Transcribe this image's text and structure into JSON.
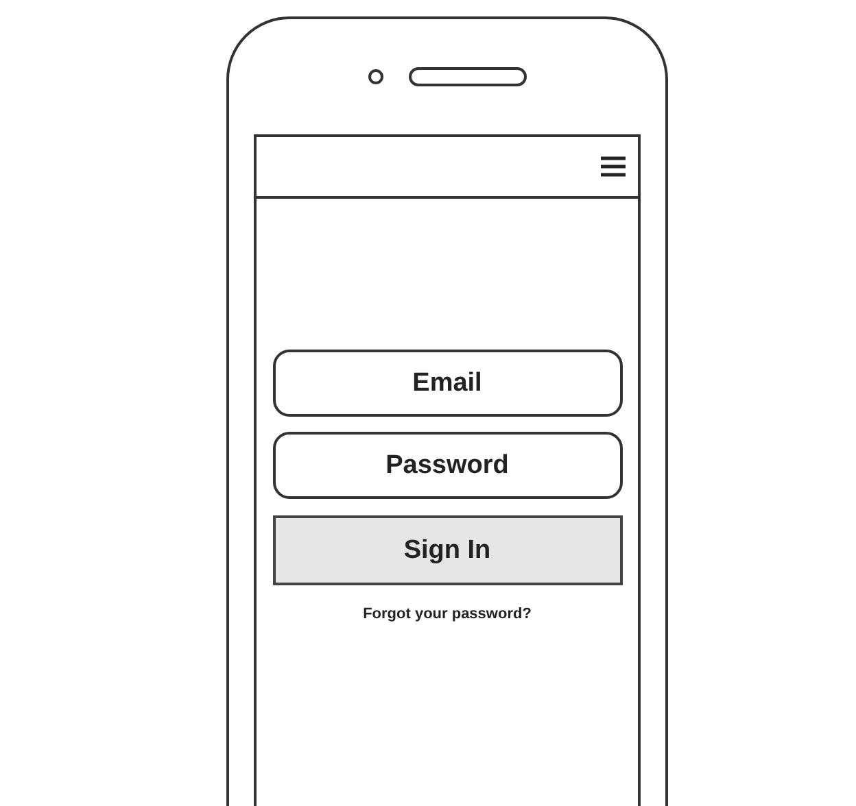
{
  "login": {
    "email": {
      "placeholder": "Email"
    },
    "password": {
      "placeholder": "Password"
    },
    "sign_in_button": "Sign In",
    "forgot_link": "Forgot your password?"
  }
}
